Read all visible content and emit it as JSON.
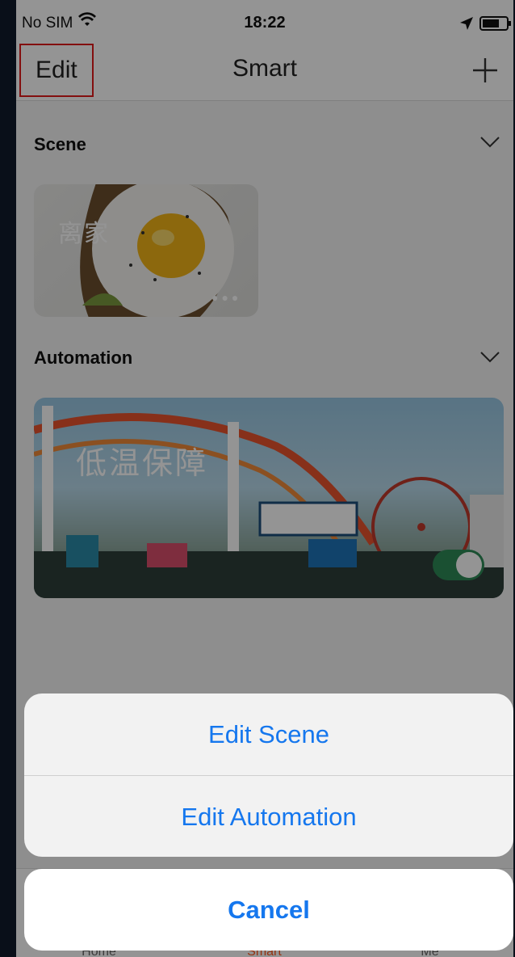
{
  "status_bar": {
    "carrier": "No SIM",
    "time": "18:22"
  },
  "nav": {
    "edit_label": "Edit",
    "title": "Smart"
  },
  "scene": {
    "title": "Scene",
    "card_label": "离家"
  },
  "automation": {
    "title": "Automation",
    "card_label": "低温保障",
    "toggle_on": true
  },
  "tabs": [
    {
      "label": "Home"
    },
    {
      "label": "Smart"
    },
    {
      "label": "Me"
    }
  ],
  "action_sheet": {
    "options": [
      "Edit Scene",
      "Edit Automation"
    ],
    "cancel_label": "Cancel"
  },
  "colors": {
    "accent": "#1577ee",
    "active_tab": "#ff5a1f",
    "toggle": "#2e8b57",
    "highlight_box": "#e21b1b"
  }
}
